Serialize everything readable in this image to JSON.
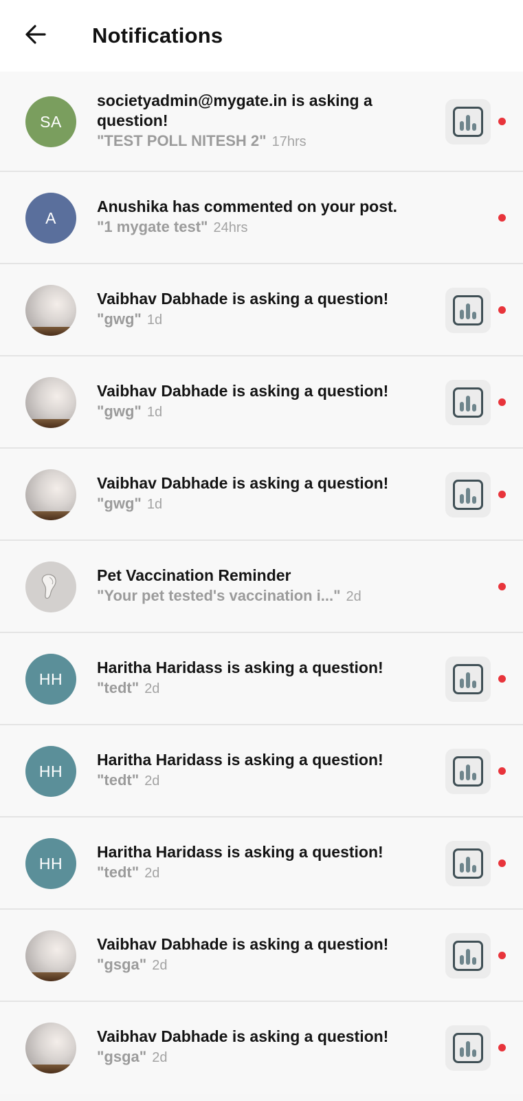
{
  "header": {
    "title": "Notifications",
    "back_icon": "arrow-left-icon"
  },
  "colors": {
    "unread_dot": "#e8343b",
    "avatar_sa": "#7a9e5e",
    "avatar_a": "#5a6f9c",
    "avatar_hh": "#5b8f99"
  },
  "notifications": [
    {
      "headline_line1": "societyadmin@mygate.in is asking a",
      "headline_line2": "question!",
      "quote": "\"TEST POLL NITESH 2\"",
      "time": "17hrs",
      "avatar_initials": "SA",
      "poll_icon": true
    },
    {
      "headline": "Anushika has commented on your post.",
      "quote": "\"1 mygate test\"",
      "time": "24hrs",
      "avatar_initials": "A",
      "poll_icon": false
    },
    {
      "headline": "Vaibhav Dabhade is asking a question!",
      "quote": "\"gwg\"",
      "time": "1d",
      "avatar_initials": "",
      "poll_icon": true
    },
    {
      "headline": "Vaibhav Dabhade is asking a question!",
      "quote": "\"gwg\"",
      "time": "1d",
      "avatar_initials": "",
      "poll_icon": true
    },
    {
      "headline": "Vaibhav Dabhade is asking a question!",
      "quote": "\"gwg\"",
      "time": "1d",
      "avatar_initials": "",
      "poll_icon": true
    },
    {
      "headline": "Pet Vaccination Reminder",
      "quote": "\"Your pet tested's vaccination i...\"",
      "time": "2d",
      "avatar_initials": "",
      "poll_icon": false
    },
    {
      "headline": "Haritha Haridass is asking a question!",
      "quote": "\"tedt\"",
      "time": "2d",
      "avatar_initials": "HH",
      "poll_icon": true
    },
    {
      "headline": "Haritha Haridass is asking a question!",
      "quote": "\"tedt\"",
      "time": "2d",
      "avatar_initials": "HH",
      "poll_icon": true
    },
    {
      "headline": "Haritha Haridass is asking a question!",
      "quote": "\"tedt\"",
      "time": "2d",
      "avatar_initials": "HH",
      "poll_icon": true
    },
    {
      "headline": "Vaibhav Dabhade is asking a question!",
      "quote": "\"gsga\"",
      "time": "2d",
      "avatar_initials": "",
      "poll_icon": true
    },
    {
      "headline": "Vaibhav Dabhade is asking a question!",
      "quote": "\"gsga\"",
      "time": "2d",
      "avatar_initials": "",
      "poll_icon": true
    }
  ]
}
